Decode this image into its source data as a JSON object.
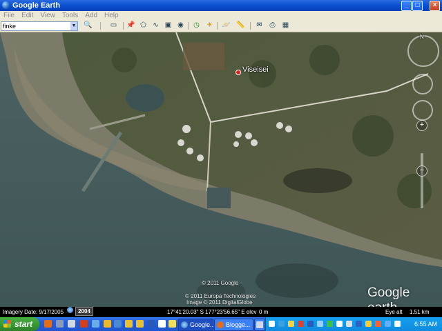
{
  "window": {
    "title": "Google Earth"
  },
  "window_controls": {
    "minimize": "_",
    "maximize": "□",
    "close": "×"
  },
  "menu": [
    "File",
    "Edit",
    "View",
    "Tools",
    "Add",
    "Help"
  ],
  "search": {
    "value": "finke"
  },
  "map": {
    "place_label": "Viseisei",
    "credits": [
      "© 2011 Google",
      "© 2011 Europa Technologies",
      "Image © 2011 DigitalGlobe"
    ],
    "brand_text": "Google earth",
    "compass_letter": "N",
    "zoom_in": "+",
    "zoom_out": "−"
  },
  "status": {
    "imagery_date": "Imagery Date: 9/17/2005",
    "year_badge": "2004",
    "coordinates": "17°41'20.03\" S  177°23'56.65\" E  elev",
    "elev_value": "0 m",
    "eye_alt_label": "Eye alt",
    "eye_alt_value": "1.51 km"
  },
  "taskbar": {
    "start_label": "start",
    "tasks": [
      "Google...",
      "Blogge...",
      ""
    ],
    "clock": "6:55 AM"
  },
  "colors": {
    "title_bar": "#0a4fd0",
    "taskbar": "#245edb",
    "start_button": "#3a9a34",
    "tray": "#0f8be0",
    "sea": "#4a5e5e",
    "land": "#5a5a40"
  }
}
